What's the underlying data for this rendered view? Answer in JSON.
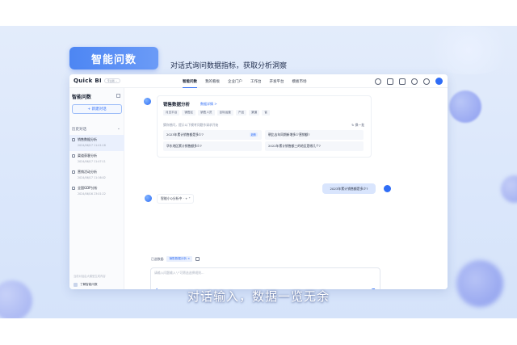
{
  "headline": {
    "pill": "智能问数",
    "tagline": "对话式询问数据指标，获取分析洞察"
  },
  "caption": "对话输入，数据一览无余",
  "app": {
    "logo": "Quick BI",
    "logo_tag": "专业版 ⌄",
    "nav": [
      "智能问数",
      "我的看板",
      "企业门户",
      "工作台",
      "开发平台",
      "模板市场"
    ],
    "icons": [
      "search-icon",
      "grid-icon",
      "message-icon",
      "gear-icon",
      "help-icon",
      "user-avatar"
    ]
  },
  "sidebar": {
    "title": "智能问数",
    "new_chat": "+ 新建对话",
    "history_label": "历史对话",
    "history_arrow": "⌄",
    "items": [
      {
        "title": "销售数据分析",
        "date": "2024/06/17 11:41:18"
      },
      {
        "title": "渠道获客分析",
        "date": "2024/06/17 11:47:11"
      },
      {
        "title": "营销活动分析",
        "date": "2024/06/17 11:16:02"
      },
      {
        "title": "全国GDP分析",
        "date": "2024/06/16 23:01:22"
      }
    ],
    "footer_note": "当前对话由大模型生成内容",
    "footer_link": "了解智能问数"
  },
  "card": {
    "title": "销售数据分析",
    "sub": "数据详情 >",
    "tags": [
      "月支平台",
      "销售区",
      "销售人员",
      "目标运营",
      "产品",
      "渠道",
      "省"
    ],
    "hint": "猜你想问，提示以下模考问题作请求开始",
    "refresh": "↻ 换一批",
    "suggestions": [
      {
        "q": "2023年累计销售额是多少?",
        "badge": "趋势"
      },
      {
        "q": "朝比去年同期新增多少营销额?",
        "badge": ""
      },
      {
        "q": "华东地区累计销售额多少?",
        "badge": ""
      },
      {
        "q": "2022年累计销售额三的地区是哪几个?",
        "badge": ""
      }
    ]
  },
  "user_message": "2023年累计销售额是多少?",
  "thinking": "智能小Q分析中 · + ⁺",
  "input": {
    "ds_label": "已选数据:",
    "ds_chip": "销售数据分析 ×",
    "placeholder": "请输入问题输入\"/\"可筛选选择规则..."
  }
}
